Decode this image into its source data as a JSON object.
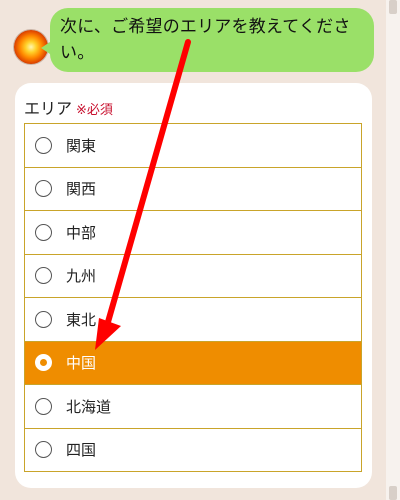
{
  "chat": {
    "message": "次に、ご希望のエリアを教えてください。"
  },
  "form": {
    "label": "エリア",
    "required": "※必須",
    "options": [
      {
        "label": "関東",
        "selected": false
      },
      {
        "label": "関西",
        "selected": false
      },
      {
        "label": "中部",
        "selected": false
      },
      {
        "label": "九州",
        "selected": false
      },
      {
        "label": "東北",
        "selected": false
      },
      {
        "label": "中国",
        "selected": true
      },
      {
        "label": "北海道",
        "selected": false
      },
      {
        "label": "四国",
        "selected": false
      }
    ]
  },
  "colors": {
    "bubble": "#9ae068",
    "selected": "#ef8d00",
    "border": "#c9a42a",
    "arrow": "#ff0000",
    "background": "#f1e5dc"
  },
  "icons": {
    "avatar": "sun-avatar-icon",
    "arrow": "red-annotation-arrow",
    "radio": "radio-button"
  }
}
